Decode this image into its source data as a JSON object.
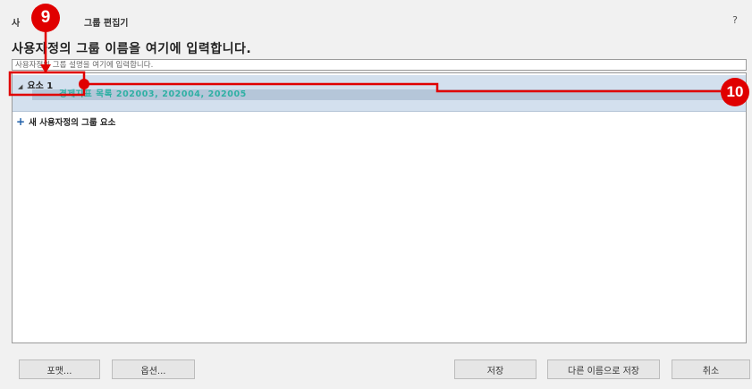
{
  "dialog": {
    "title_prefix": "사",
    "title_suffix": "그룹 편집기",
    "help_label": "?"
  },
  "group": {
    "name": "사용자정의 그룹 이름을 여기에 입력합니다.",
    "description": "사용자정의 그룹 설명을 여기에 입력합니다."
  },
  "tree": {
    "element_collapse_icon": "◢",
    "element_label": "요소 1",
    "element_value": "경제지표 목록 202003, 202004, 202005",
    "add_icon": "+",
    "add_label": "새 사용자정의 그룹 요소"
  },
  "buttons": {
    "format": "포맷...",
    "options": "옵션...",
    "save": "저장",
    "save_as": "다른 이름으로 저장",
    "cancel": "취소"
  },
  "annotations": {
    "badge_9": "9",
    "badge_10": "10",
    "color": "#e00000"
  }
}
